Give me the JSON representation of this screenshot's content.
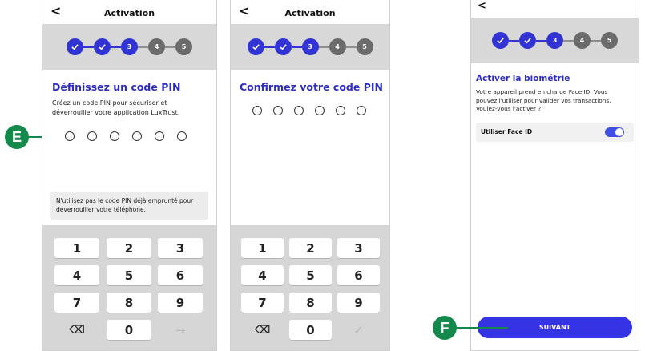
{
  "colors": {
    "accent": "#3133d3",
    "callout": "#138a4c",
    "step_todo": "#6b6b6b"
  },
  "screens": [
    {
      "title": "Activation",
      "steps": [
        "",
        "",
        "3",
        "4",
        "5"
      ],
      "heading": "Définissez un code PIN",
      "desc_line1": "Créez un code PIN pour sécuriser et",
      "desc_line2": "déverrouiller votre application LuxTrust.",
      "notice_line1": "N'utilisez pas le code PIN déjà emprunté pour",
      "notice_line2": "déverrouiller votre téléphone.",
      "keys": [
        "1",
        "2",
        "3",
        "4",
        "5",
        "6",
        "7",
        "8",
        "9",
        "⌫",
        "0",
        "→"
      ]
    },
    {
      "title": "Activation",
      "steps": [
        "",
        "",
        "3",
        "4",
        "5"
      ],
      "heading": "Confirmez votre code PIN",
      "keys": [
        "1",
        "2",
        "3",
        "4",
        "5",
        "6",
        "7",
        "8",
        "9",
        "⌫",
        "0",
        "✓"
      ]
    },
    {
      "steps": [
        "",
        "",
        "3",
        "4",
        "5"
      ],
      "heading": "Activer la biométrie",
      "desc_line1": "Votre appareil prend en charge Face ID. Vous",
      "desc_line2": "pouvez l'utiliser pour valider vos transactions.",
      "desc_line3": "Voulez-vous l'activer ?",
      "toggle_label": "Utiliser Face ID",
      "button_label": "SUIVANT"
    }
  ],
  "back_label": "<",
  "callouts": {
    "e": "E",
    "f": "F"
  },
  "icons": {
    "step_done": "check-icon",
    "backspace": "backspace-icon",
    "next": "arrow-right-icon",
    "confirm": "check-icon"
  }
}
